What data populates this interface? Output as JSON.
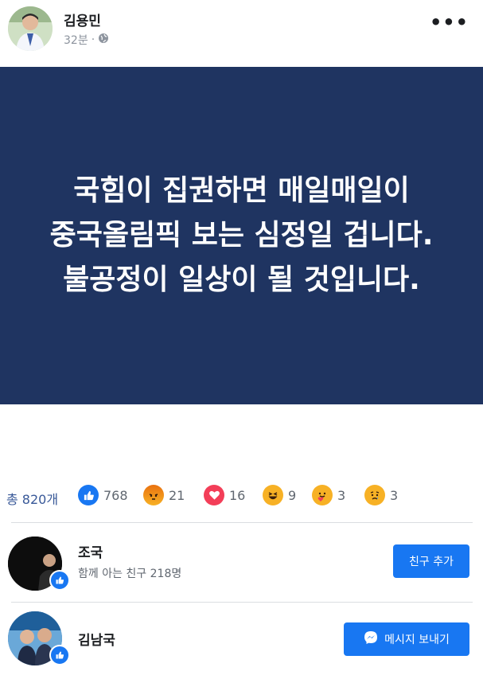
{
  "post": {
    "author": "김용민",
    "time": "32분",
    "separator": "·",
    "globe_icon": "globe-icon",
    "more_icon": "more-icon",
    "text": "국힘이 집권하면 매일매일이 중국올림픽 보는 심정일 겁니다. 불공정이 일상이 될 것입니다.",
    "card_color": "#1f3461"
  },
  "reactions": {
    "total": "총 820개",
    "items": [
      {
        "icon": "like-icon",
        "count": "768"
      },
      {
        "icon": "angry-icon",
        "count": "21"
      },
      {
        "icon": "love-icon",
        "count": "16"
      },
      {
        "icon": "haha-icon",
        "count": "9"
      },
      {
        "icon": "care-icon",
        "count": "3"
      },
      {
        "icon": "sad-icon",
        "count": "3"
      }
    ]
  },
  "people": [
    {
      "name": "조국",
      "mutual": "함께 아는 친구 218명",
      "button": "친구 추가",
      "badge": "like-icon"
    },
    {
      "name": "김남국",
      "mutual": "",
      "button": "메시지 보내기",
      "button_icon": "messenger-icon",
      "badge": "like-icon"
    }
  ],
  "colors": {
    "accent": "#1877f2",
    "link": "#385898"
  }
}
